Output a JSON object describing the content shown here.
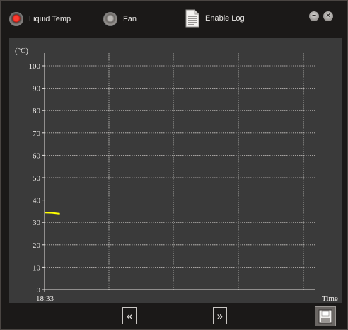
{
  "legend": {
    "liquid_temp_label": "Liquid Temp",
    "fan_label": "Fan",
    "enable_log_label": "Enable Log"
  },
  "icons": {
    "liquid_indicator": "red-radio-icon",
    "fan_indicator": "gray-radio-icon",
    "log": "document-icon",
    "minimize": "minimize-icon",
    "close": "close-icon",
    "prev": "double-chevron-left-icon",
    "next": "double-chevron-right-icon",
    "save": "save-icon"
  },
  "colors": {
    "liquid_series": "#ffff00",
    "background": "#1b1918",
    "plot_background": "#3a3a3a"
  },
  "chart_data": {
    "type": "line",
    "ylabel": "(°C)",
    "xlabel": "Time",
    "ylim": [
      0,
      100
    ],
    "yticks": [
      "0",
      "10",
      "20",
      "30",
      "40",
      "50",
      "60",
      "70",
      "80",
      "90",
      "100"
    ],
    "x_start_label": "18:33",
    "grid": true,
    "series": [
      {
        "color": "#ffff00",
        "points": [
          {
            "x": 0,
            "y": 34.4
          },
          {
            "x": 0.3,
            "y": 34.3
          },
          {
            "x": 0.6,
            "y": 33.9
          }
        ]
      }
    ]
  }
}
